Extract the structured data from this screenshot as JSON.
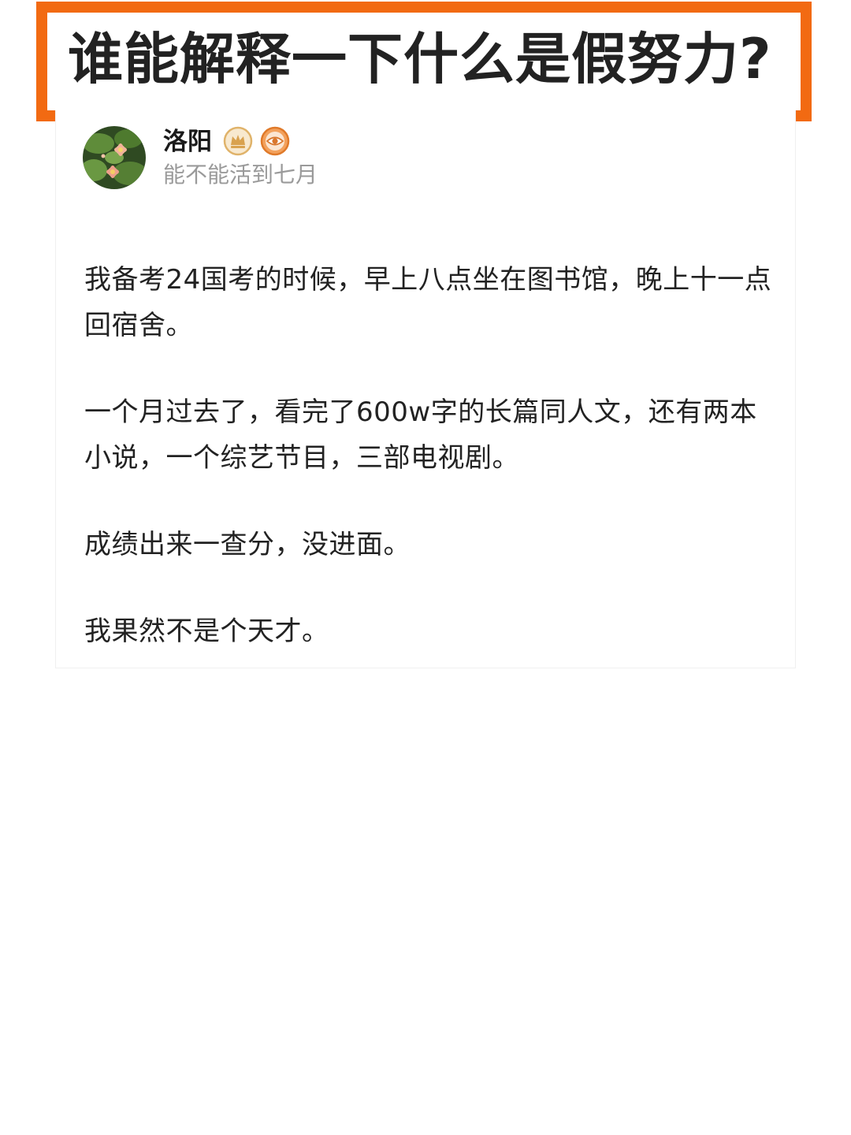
{
  "title": "谁能解释一下什么是假努力?",
  "colors": {
    "accent_frame": "#f26a12",
    "text_primary": "#222222",
    "text_secondary": "#9a9a9a"
  },
  "post": {
    "user": {
      "name": "洛阳",
      "subtitle": "能不能活到七月",
      "avatar_icon": "lotus-avatar-icon",
      "badges": [
        "crown-badge-icon",
        "eye-badge-icon"
      ]
    },
    "paragraphs": [
      "我备考24国考的时候，早上八点坐在图书馆，晚上十一点回宿舍。",
      "一个月过去了，看完了600w字的长篇同人文，还有两本小说，一个综艺节目，三部电视剧。",
      "成绩出来一查分，没进面。",
      "我果然不是个天才。"
    ]
  }
}
